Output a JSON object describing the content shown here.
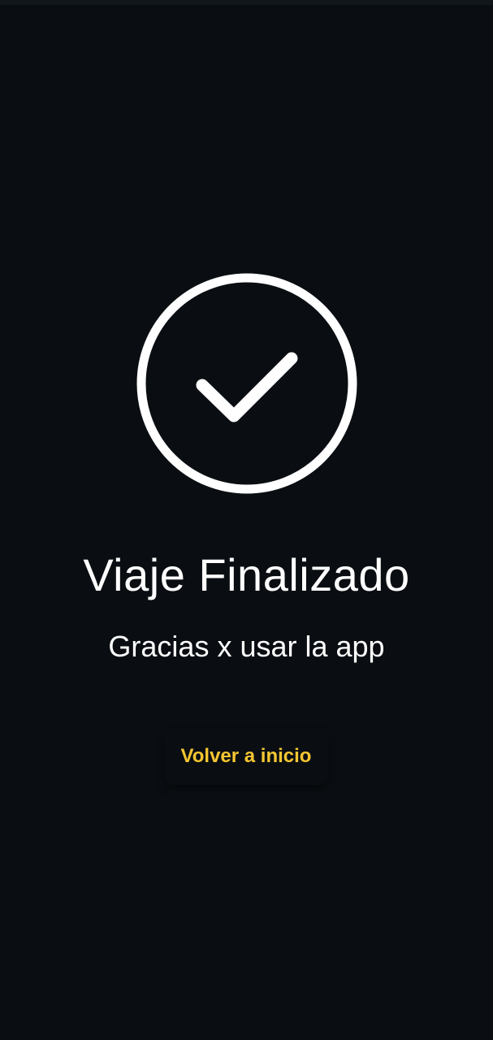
{
  "screen": {
    "title": "Viaje Finalizado",
    "subtitle": "Gracias x usar la app",
    "home_button_label": "Volver a inicio",
    "icon": "check-circle-icon"
  },
  "colors": {
    "background": "#0a0e12",
    "text": "#ffffff",
    "accent": "#f5c631"
  }
}
